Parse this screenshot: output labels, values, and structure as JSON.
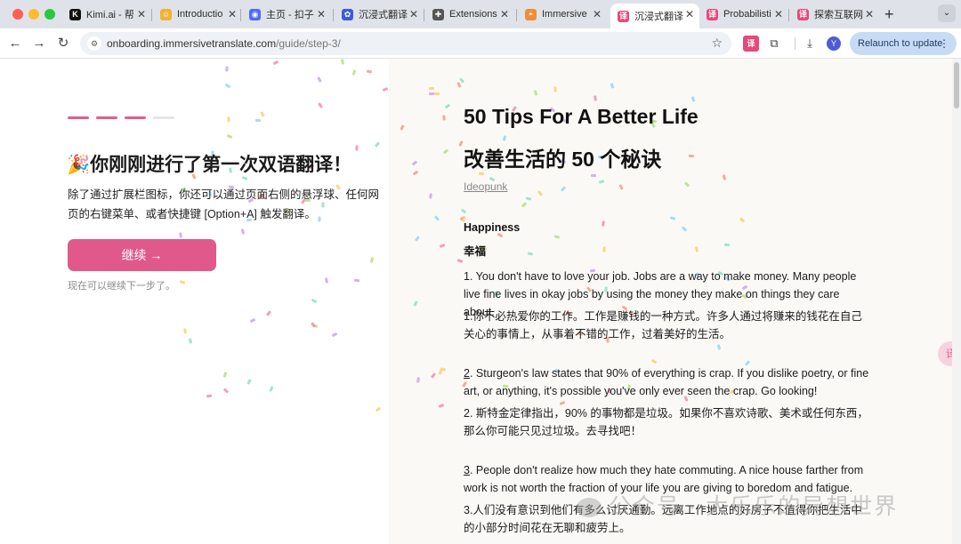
{
  "browser": {
    "tabs": [
      {
        "title": "Kimi.ai - 帮",
        "favicon": "K",
        "favicon_color": "#111111"
      },
      {
        "title": "Introductio",
        "favicon": "☺",
        "favicon_color": "#f2b233"
      },
      {
        "title": "主页 - 扣子",
        "favicon": "◉",
        "favicon_color": "#4d6bfe"
      },
      {
        "title": "沉浸式翻译",
        "favicon": "✿",
        "favicon_color": "#3b5bdb"
      },
      {
        "title": "Extensions",
        "favicon": "✚",
        "favicon_color": "#555555"
      },
      {
        "title": "Immersive",
        "favicon": "◓",
        "favicon_color": "#f28c38"
      },
      {
        "title": "沉浸式翻译",
        "favicon": "译",
        "favicon_color": "#e8477a"
      },
      {
        "title": "Probabilisti",
        "favicon": "译",
        "favicon_color": "#e8477a"
      },
      {
        "title": "探索互联网",
        "favicon": "译",
        "favicon_color": "#e8477a"
      }
    ],
    "active_tab_index": 6,
    "url_host": "onboarding.immersivetranslate.com",
    "url_path": "/guide/step-3/",
    "avatar_letter": "Y",
    "relaunch_label": "Relaunch to update"
  },
  "onboarding": {
    "steps_total": 4,
    "steps_done": 3,
    "emoji": "🎉",
    "heading": "你刚刚进行了第一次双语翻译！",
    "description": "除了通过扩展栏图标，你还可以通过页面右侧的悬浮球、任何网页的右键菜单、或者快捷键 [Option+A] 触发翻译。",
    "continue_label": "继续 →",
    "hint": "现在可以继续下一步了。"
  },
  "article": {
    "title": "50 Tips For A Better Life",
    "title_zh": "改善生活的 50 个秘诀",
    "author": "Ideopunk",
    "section": "Happiness",
    "section_zh": "幸福",
    "p1": "1. You don't have to love your job. Jobs are a way to make money. Many people live fine lives in okay jobs by using the money they make on things they care about.",
    "p1_zh": "1.你不必热爱你的工作。工作是赚钱的一种方式。许多人通过将赚来的钱花在自己关心的事情上，从事着不错的工作，过着美好的生活。",
    "p2_num": "2",
    "p2": ". Sturgeon's law states that 90% of everything is crap. If you dislike poetry, or fine art, or anything, it's possible you've only ever seen the crap. Go looking!",
    "p2_zh": "2. 斯特金定律指出，90% 的事物都是垃圾。如果你不喜欢诗歌、美术或任何东西，那么你可能只见过垃圾。去寻找吧！",
    "p3_num": "3",
    "p3": ". People don't realize how much they hate commuting. A nice house farther from work is not worth the fraction of your life you are giving to boredom and fatigue.",
    "p3_zh": "3.人们没有意识到他们有多么讨厌通勤。远离工作地点的好房子不值得你把生活中的小部分时间花在无聊和疲劳上。"
  },
  "floating_ball_label": "译",
  "watermark": "公众号 · 大乐乐的异想世界",
  "colors": {
    "accent": "#e0598a",
    "confetti": [
      "#f28cb5",
      "#9bd3f5",
      "#b7e07a",
      "#c9a3f0",
      "#f7d36a",
      "#8fe0c8",
      "#f59b8b"
    ]
  }
}
